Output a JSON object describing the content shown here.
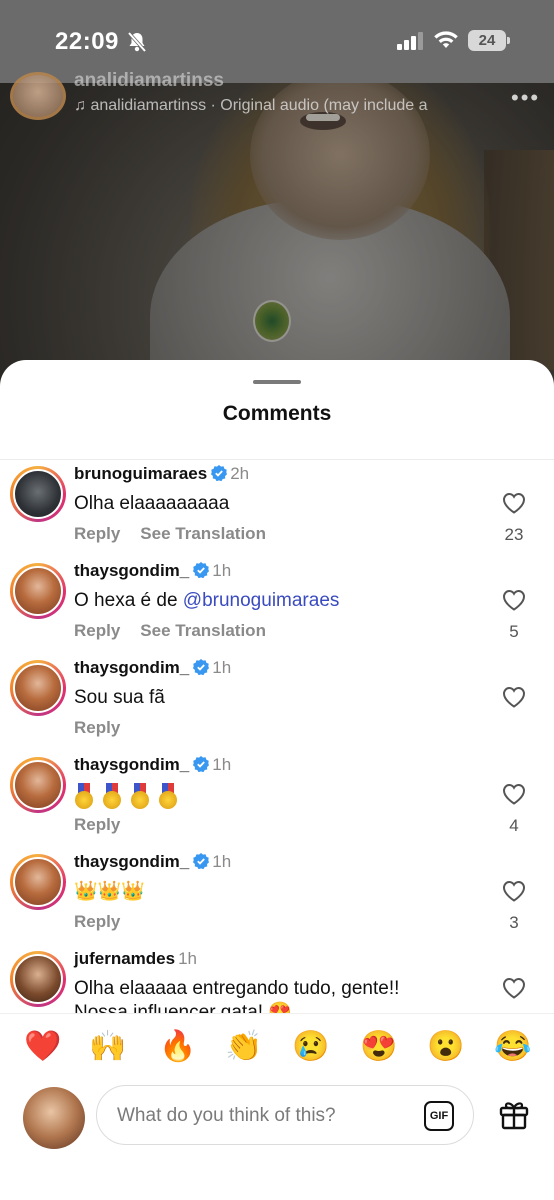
{
  "status_bar": {
    "time": "22:09",
    "battery": "24"
  },
  "reel": {
    "username": "analidiamartinss",
    "audio": "analidiamartinss · Original audio  (may include a",
    "more": "•••"
  },
  "sheet": {
    "title": "Comments",
    "comments": [
      {
        "user": "brunoguimaraes",
        "verified": true,
        "time": "2h",
        "text": "Olha elaaaaaaaaa",
        "actions": [
          "Reply",
          "See Translation"
        ],
        "likes": "23",
        "avatar": "bruno"
      },
      {
        "user": "thaysgondim_",
        "verified": true,
        "time": "1h",
        "text_prefix": "O hexa é de ",
        "mention": "@brunoguimaraes",
        "actions": [
          "Reply",
          "See Translation"
        ],
        "likes": "5",
        "avatar": "thays"
      },
      {
        "user": "thaysgondim_",
        "verified": true,
        "time": "1h",
        "text": "Sou sua fã",
        "actions": [
          "Reply"
        ],
        "likes": "",
        "avatar": "thays"
      },
      {
        "user": "thaysgondim_",
        "verified": true,
        "time": "1h",
        "text": "",
        "emoji_row": "medal x4",
        "actions": [
          "Reply"
        ],
        "likes": "4",
        "avatar": "thays"
      },
      {
        "user": "thaysgondim_",
        "verified": true,
        "time": "1h",
        "text": "👑👑👑",
        "actions": [
          "Reply"
        ],
        "likes": "3",
        "avatar": "thays"
      },
      {
        "user": "jufernamdes",
        "verified": false,
        "time": "1h",
        "text": "Olha elaaaaa entregando tudo, gente!! Nossa influencer gata! 😍",
        "actions": [],
        "likes": "",
        "avatar": "ju"
      }
    ]
  },
  "reactions": [
    "❤️",
    "🙌",
    "🔥",
    "👏",
    "😢",
    "😍",
    "😮",
    "😂"
  ],
  "composer": {
    "placeholder": "What do you think of this?",
    "gif_label": "GIF"
  },
  "colors": {
    "verified": "#3897f0",
    "mention": "#3a4bbf",
    "muted": "#8a8a8a"
  }
}
